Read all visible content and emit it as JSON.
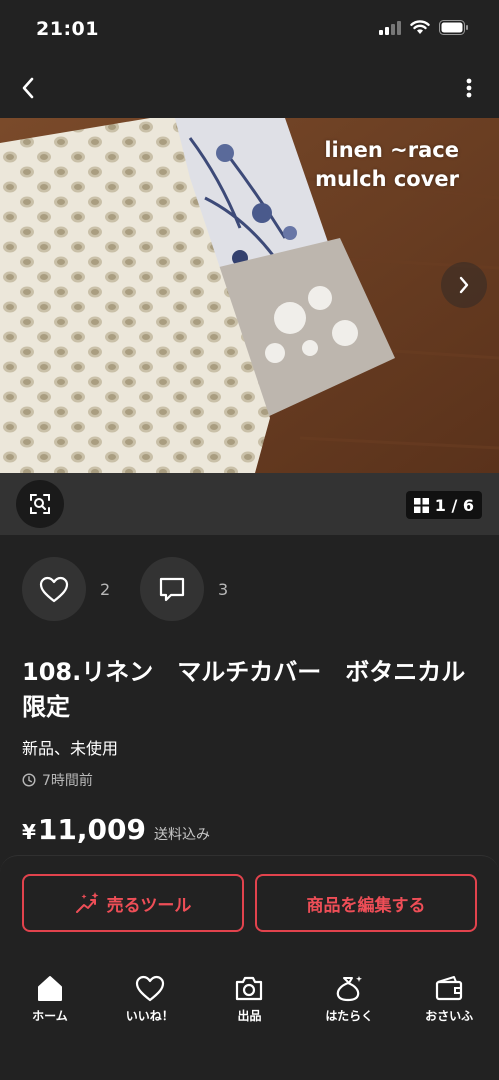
{
  "status": {
    "time": "21:01"
  },
  "photo": {
    "overlay_text_line1": "linen ~race",
    "overlay_text_line2": "mulch cover",
    "page_indicator": "1 / 6"
  },
  "reactions": {
    "likes": "2",
    "comments": "3"
  },
  "item": {
    "title": "108.リネン　マルチカバー　ボタニカル　限定",
    "condition": "新品、未使用",
    "posted": "7時間前",
    "price_symbol": "¥",
    "price": "11,009",
    "shipping_note": "送料込み"
  },
  "buttons": {
    "sell_tool": "売るツール",
    "edit_item": "商品を編集する"
  },
  "tabs": [
    {
      "label": "ホーム",
      "icon": "home-icon"
    },
    {
      "label": "いいね！",
      "icon": "heart-icon"
    },
    {
      "label": "出品",
      "icon": "camera-icon"
    },
    {
      "label": "はたらく",
      "icon": "money-bag-icon"
    },
    {
      "label": "おさいふ",
      "icon": "wallet-icon"
    }
  ],
  "colors": {
    "background": "#222222",
    "accent": "#e2434d",
    "surface": "#333333"
  }
}
